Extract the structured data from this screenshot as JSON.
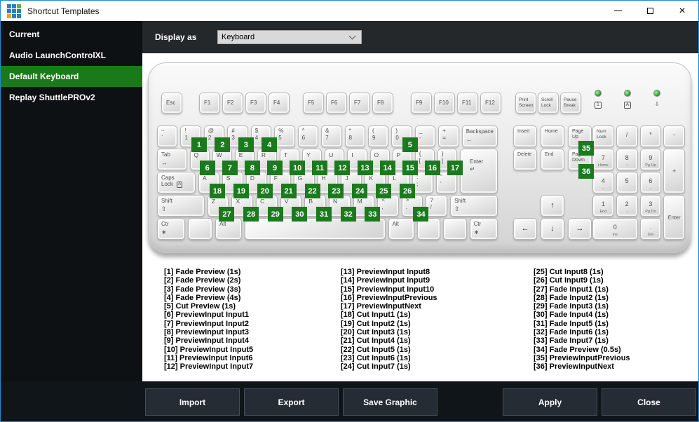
{
  "window": {
    "title": "Shortcut Templates",
    "controls": {
      "close": "×"
    },
    "logo_colors": [
      "#2a7fc1",
      "#2a7fc1",
      "#58b647",
      "#2a7fc1",
      "#2a7fc1",
      "#2a7fc1",
      "#f0a30a",
      "#2a7fc1",
      "#2a7fc1"
    ],
    "border_color": "#1e8bd4"
  },
  "sidebar": {
    "selected_color": "#1a7a1a",
    "items": [
      {
        "label": "Current",
        "selected": false
      },
      {
        "label": "Audio LaunchControlXL",
        "selected": false
      },
      {
        "label": "Default Keyboard",
        "selected": true
      },
      {
        "label": "Replay ShuttlePROv2",
        "selected": false
      }
    ]
  },
  "toolbar": {
    "display_as_label": "Display as",
    "display_as_value": "Keyboard"
  },
  "keyboard": {
    "esc": "Esc",
    "function_groups": [
      [
        "F1",
        "F2",
        "F3",
        "F4"
      ],
      [
        "F5",
        "F6",
        "F7",
        "F8"
      ],
      [
        "F9",
        "F10",
        "F11",
        "F12"
      ]
    ],
    "system_keys": [
      "Print Screen",
      "Scroll Lock",
      "Pause Break"
    ],
    "leds": [
      {
        "id": "num-lock",
        "glyph": "1",
        "boxed": true
      },
      {
        "id": "caps-lock",
        "glyph": "A",
        "boxed": true
      },
      {
        "id": "scroll-lock",
        "glyph": "⇩",
        "boxed": false
      }
    ],
    "alpha_rows": [
      {
        "keys": [
          {
            "t": "~",
            "b": "`"
          },
          {
            "t": "!",
            "b": "1",
            "badge": "1"
          },
          {
            "t": "@",
            "b": "2",
            "badge": "2"
          },
          {
            "t": "#",
            "b": "3",
            "badge": "3"
          },
          {
            "t": "$",
            "b": "4",
            "badge": "4"
          },
          {
            "t": "%",
            "b": "5"
          },
          {
            "t": "^",
            "b": "6"
          },
          {
            "t": "&",
            "b": "7"
          },
          {
            "t": "*",
            "b": "8"
          },
          {
            "t": "(",
            "b": "9"
          },
          {
            "t": ")",
            "b": "0",
            "badge": "5"
          },
          {
            "t": "_",
            "b": "-"
          },
          {
            "t": "+",
            "b": "="
          },
          {
            "label": "Backspace",
            "sub": "←",
            "w": 1.8,
            "name": "backspace"
          }
        ]
      },
      {
        "reserve": true,
        "keys": [
          {
            "label": "Tab",
            "sub": "↔",
            "w": 1.55,
            "name": "tab"
          },
          {
            "ch": "Q",
            "badge": "6"
          },
          {
            "ch": "W",
            "badge": "7"
          },
          {
            "ch": "E",
            "badge": "8"
          },
          {
            "ch": "R",
            "badge": "9"
          },
          {
            "ch": "T",
            "badge": "10"
          },
          {
            "ch": "Y",
            "badge": "11"
          },
          {
            "ch": "U",
            "badge": "12"
          },
          {
            "ch": "I",
            "badge": "13"
          },
          {
            "ch": "O",
            "badge": "14"
          },
          {
            "ch": "P",
            "badge": "15"
          },
          {
            "t": "{",
            "b": "[",
            "badge": "16"
          },
          {
            "t": "}",
            "b": "]",
            "badge": "17"
          }
        ]
      },
      {
        "reserve": true,
        "keys": [
          {
            "label": "Caps\nLock",
            "sub_boxed": "A",
            "w": 1.9,
            "name": "caps-lock"
          },
          {
            "ch": "A",
            "badge": "18"
          },
          {
            "ch": "S",
            "badge": "19"
          },
          {
            "ch": "D",
            "badge": "20"
          },
          {
            "ch": "F",
            "badge": "21"
          },
          {
            "ch": "G",
            "badge": "22"
          },
          {
            "ch": "H",
            "badge": "23"
          },
          {
            "ch": "J",
            "badge": "24"
          },
          {
            "ch": "K",
            "badge": "25"
          },
          {
            "ch": "L",
            "badge": "26"
          },
          {
            "t": ":",
            "b": ";"
          },
          {
            "t": "\"",
            "b": "'"
          }
        ]
      },
      {
        "keys": [
          {
            "label": "Shift",
            "sub": "⇧",
            "w": 2.3,
            "name": "shift-left"
          },
          {
            "ch": "Z",
            "badge": "27"
          },
          {
            "ch": "X",
            "badge": "28"
          },
          {
            "ch": "C",
            "badge": "29"
          },
          {
            "ch": "V",
            "badge": "30"
          },
          {
            "ch": "B",
            "badge": "31"
          },
          {
            "ch": "N",
            "badge": "32"
          },
          {
            "ch": "M",
            "badge": "33"
          },
          {
            "t": "<",
            "b": ","
          },
          {
            "t": ">",
            "b": ".",
            "badge": "34"
          },
          {
            "t": "?",
            "b": "/"
          },
          {
            "label": "Shift",
            "sub": "⇧",
            "w": 2.3,
            "name": "shift-right"
          }
        ]
      },
      {
        "keys": [
          {
            "label": "Ctr",
            "sub": "∗",
            "w": 1.35,
            "name": "ctrl-left"
          },
          {
            "label": "",
            "w": 1.15,
            "name": "win-left"
          },
          {
            "label": "Alt",
            "w": 1.25,
            "name": "alt-left"
          },
          {
            "label": "",
            "w": 7,
            "name": "space"
          },
          {
            "label": "Alt",
            "w": 1.25,
            "name": "alt-right"
          },
          {
            "label": "",
            "w": 1.1,
            "name": "win-right"
          },
          {
            "label": "",
            "w": 1.1,
            "name": "menu"
          },
          {
            "label": "Ctr",
            "sub": "∗",
            "w": 1.35,
            "name": "ctrl-right"
          }
        ]
      }
    ],
    "enter_label": "Enter",
    "enter_sub": "↵",
    "nav_rows": [
      [
        {
          "label": "Insert"
        },
        {
          "label": "Home"
        },
        {
          "label": "Page Up",
          "badge": "35",
          "name": "page-up"
        }
      ],
      [
        {
          "label": "Delete"
        },
        {
          "label": "End"
        },
        {
          "label": "Page Down",
          "badge": "36",
          "name": "page-down"
        }
      ]
    ],
    "arrows": {
      "up": "↑",
      "left": "←",
      "down": "↓",
      "right": "→"
    },
    "numpad": [
      {
        "main": "Num Lock",
        "name": "num-lock",
        "small": true
      },
      {
        "main": "/",
        "name": "divide"
      },
      {
        "main": "*",
        "name": "multiply"
      },
      {
        "main": "-",
        "name": "subtract"
      },
      {
        "main": "7",
        "sub": "Home"
      },
      {
        "main": "8",
        "sub": "↑"
      },
      {
        "main": "9",
        "sub": "Pg Up"
      },
      {
        "main": "+",
        "name": "add",
        "tall": true
      },
      {
        "main": "4",
        "sub": "←"
      },
      {
        "main": "5"
      },
      {
        "main": "6",
        "sub": "→"
      },
      {
        "main": "1",
        "sub": "End"
      },
      {
        "main": "2",
        "sub": "↓"
      },
      {
        "main": "3",
        "sub": "Pg Dn"
      },
      {
        "main": "Enter",
        "name": "enter",
        "tall": true,
        "small": true
      },
      {
        "main": "0",
        "sub": "Ins",
        "wide": true
      },
      {
        "main": ".",
        "sub": "Del",
        "name": "decimal"
      }
    ]
  },
  "shortcuts": {
    "columns": [
      [
        "[1] Fade Preview (1s)",
        "[2] Fade Preview (2s)",
        "[3] Fade Preview (3s)",
        "[4] Fade Preview (4s)",
        "[5] Cut Preview (1s)",
        "[6] PreviewInput Input1",
        "[7] PreviewInput Input2",
        "[8] PreviewInput Input3",
        "[9] PreviewInput Input4",
        "[10] PreviewInput Input5",
        "[11] PreviewInput Input6",
        "[12] PreviewInput Input7"
      ],
      [
        "[13] PreviewInput Input8",
        "[14] PreviewInput Input9",
        "[15] PreviewInput Input10",
        "[16] PreviewInputPrevious",
        "[17] PreviewInputNext",
        "[18] Cut Input1 (1s)",
        "[19] Cut Input2 (1s)",
        "[20] Cut Input3 (1s)",
        "[21] Cut Input4 (1s)",
        "[22] Cut Input5 (1s)",
        "[23] Cut Input6 (1s)",
        "[24] Cut Input7 (1s)"
      ],
      [
        "[25] Cut Input8 (1s)",
        "[26] Cut Input9 (1s)",
        "[27] Fade Input1 (1s)",
        "[28] Fade Input2 (1s)",
        "[29] Fade Input3 (1s)",
        "[30] Fade Input4 (1s)",
        "[31] Fade Input5 (1s)",
        "[32] Fade Input6 (1s)",
        "[33] Fade Input7 (1s)",
        "[34] Fade Preview (0.5s)",
        "[35] PreviewInputPrevious",
        "[36] PreviewInputNext"
      ]
    ]
  },
  "footer": {
    "buttons": [
      "Import",
      "Export",
      "Save Graphic",
      "Apply",
      "Close"
    ]
  },
  "colors": {
    "badge_green": "#1b7a1d",
    "selection_green": "#1a7a1a",
    "led_green": "#2fa32f"
  }
}
